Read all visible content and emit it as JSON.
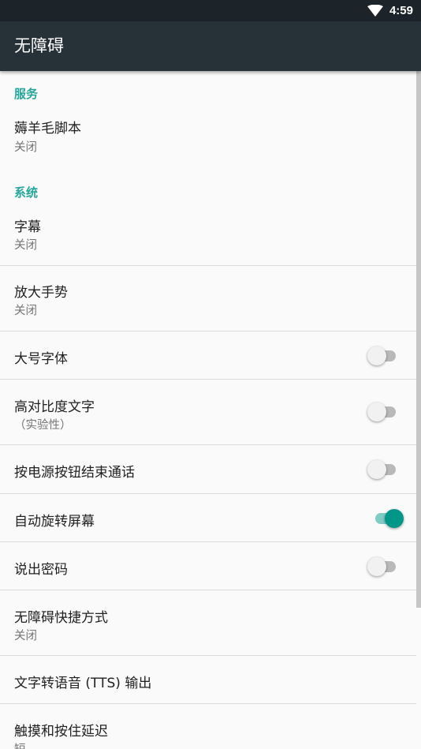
{
  "status_bar": {
    "time": "4:59"
  },
  "app_bar": {
    "title": "无障碍"
  },
  "sections": {
    "services": {
      "header": "服务"
    },
    "system": {
      "header": "系统"
    }
  },
  "items": {
    "sheep": {
      "title": "薅羊毛脚本",
      "summary": "关闭"
    },
    "captions": {
      "title": "字幕",
      "summary": "关闭"
    },
    "magnify": {
      "title": "放大手势",
      "summary": "关闭"
    },
    "large_text": {
      "title": "大号字体",
      "checked": false
    },
    "high_contrast": {
      "title": "高对比度文字",
      "summary": "（实验性）",
      "checked": false
    },
    "power_end_call": {
      "title": "按电源按钮结束通话",
      "checked": false
    },
    "auto_rotate": {
      "title": "自动旋转屏幕",
      "checked": true
    },
    "speak_passwords": {
      "title": "说出密码",
      "checked": false
    },
    "shortcut": {
      "title": "无障碍快捷方式",
      "summary": "关闭"
    },
    "tts": {
      "title": "文字转语音 (TTS) 输出"
    },
    "touch_delay": {
      "title": "触摸和按住延迟",
      "summary": "短"
    }
  },
  "colors": {
    "accent": "#009688",
    "app_bar": "#263238",
    "status_bar": "#1c2429"
  }
}
